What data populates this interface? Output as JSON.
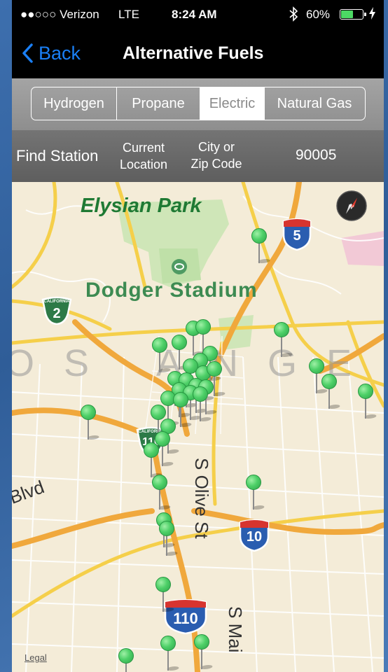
{
  "status_bar": {
    "signal": "●●○○○ Verizon",
    "network": "LTE",
    "time": "8:24 AM",
    "bluetooth_icon": "bluetooth-icon",
    "battery_percent": "60%",
    "battery_level": 0.6
  },
  "nav": {
    "back_label": "Back",
    "title": "Alternative Fuels"
  },
  "segments": {
    "items": [
      {
        "label": "Hydrogen"
      },
      {
        "label": "Propane"
      },
      {
        "label": "Electric"
      },
      {
        "label": "Natural Gas"
      }
    ],
    "selected": "Electric"
  },
  "find": {
    "label": "Find Station",
    "current_location_line1": "Current",
    "current_location_line2": "Location",
    "city_zip_line1": "City or",
    "city_zip_line2": "Zip Code",
    "zip_value": "90005"
  },
  "map": {
    "labels": {
      "park": "Elysian Park",
      "stadium": "Dodger Stadium",
      "city": "OS ANGELE",
      "olive": "S Olive St",
      "main": "S Mai",
      "blvd": "Blvd",
      "legal": "Legal"
    },
    "shields": {
      "i5": "5",
      "ca2": "2",
      "ca2_top": "CALIFORNIA",
      "i10": "10",
      "i110": "110",
      "ca110_top": "CALIFORNIA",
      "ca110": "110"
    },
    "pin_color": "#4ed068",
    "station_count": 34
  },
  "colors": {
    "accent": "#1a7ff5",
    "pin": "#4ed068"
  }
}
